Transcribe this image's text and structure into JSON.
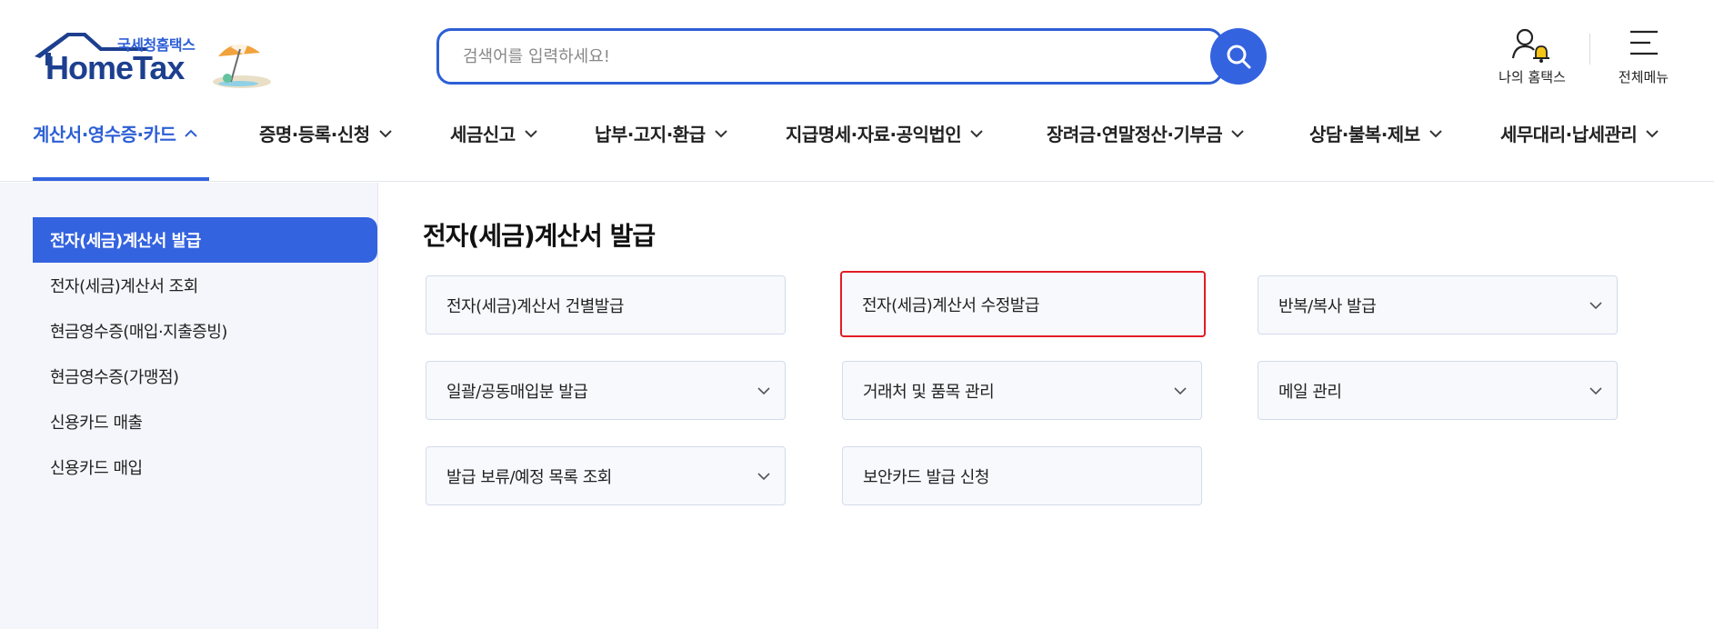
{
  "header": {
    "logo_sub": "국세청홈택스",
    "logo_main": "HomeTax",
    "search_placeholder": "검색어를 입력하세요!",
    "my_hometax_label": "나의 홈택스",
    "all_menu_label": "전체메뉴"
  },
  "nav": {
    "items": [
      {
        "label": "계산서·영수증·카드",
        "active": true
      },
      {
        "label": "증명·등록·신청"
      },
      {
        "label": "세금신고"
      },
      {
        "label": "납부·고지·환급"
      },
      {
        "label": "지급명세·자료·공익법인"
      },
      {
        "label": "장려금·연말정산·기부금"
      },
      {
        "label": "상담·불복·제보"
      },
      {
        "label": "세무대리·납세관리"
      }
    ]
  },
  "sidebar": {
    "items": [
      {
        "label": "전자(세금)계산서 발급",
        "active": true
      },
      {
        "label": "전자(세금)계산서 조회"
      },
      {
        "label": "현금영수증(매입·지출증빙)"
      },
      {
        "label": "현금영수증(가맹점)"
      },
      {
        "label": "신용카드 매출"
      },
      {
        "label": "신용카드 매입"
      }
    ]
  },
  "main": {
    "title": "전자(세금)계산서 발급",
    "cards": [
      {
        "label": "전자(세금)계산서 건별발급",
        "expandable": false
      },
      {
        "label": "전자(세금)계산서 수정발급",
        "expandable": false,
        "highlighted": true
      },
      {
        "label": "반복/복사 발급",
        "expandable": true
      },
      {
        "label": "일괄/공동매입분 발급",
        "expandable": true
      },
      {
        "label": "거래처 및 품목 관리",
        "expandable": true
      },
      {
        "label": "메일 관리",
        "expandable": true
      },
      {
        "label": "발급 보류/예정 목록 조회",
        "expandable": true
      },
      {
        "label": "보안카드 발급 신청",
        "expandable": false
      }
    ]
  },
  "colors": {
    "accent": "#3463e0",
    "highlight": "#e21c25",
    "logo_navy": "#1d3f8f"
  }
}
